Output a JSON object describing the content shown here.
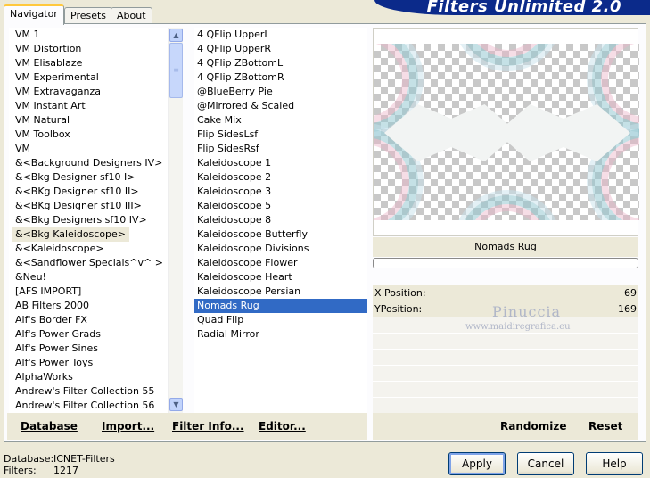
{
  "banner": {
    "title": "Filters Unlimited 2.0"
  },
  "tabs": [
    {
      "label": "Navigator",
      "active": true
    },
    {
      "label": "Presets",
      "active": false
    },
    {
      "label": "About",
      "active": false
    }
  ],
  "categories": [
    "VM 1",
    "VM Distortion",
    "VM Elisablaze",
    "VM Experimental",
    "VM Extravaganza",
    "VM Instant Art",
    "VM Natural",
    "VM Toolbox",
    "VM",
    "&<Background Designers IV>",
    "&<Bkg Designer sf10 I>",
    "&<BKg Designer sf10 II>",
    "&<BKg Designer sf10 III>",
    "&<Bkg Designers sf10 IV>",
    "&<Bkg Kaleidoscope>",
    "&<Kaleidoscope>",
    "&<Sandflower Specials^v^ >",
    "&Neu!",
    "[AFS IMPORT]",
    "AB Filters 2000",
    "Alf's Border FX",
    "Alf's Power Grads",
    "Alf's Power Sines",
    "Alf's Power Toys",
    "AlphaWorks",
    "Andrew's Filter Collection 55",
    "Andrew's Filter Collection 56"
  ],
  "selected_category": "&<Bkg Kaleidoscope>",
  "filters": [
    "4 QFlip UpperL",
    "4 QFlip UpperR",
    "4 QFlip ZBottomL",
    "4 QFlip ZBottomR",
    "@BlueBerry Pie",
    "@Mirrored & Scaled",
    "Cake Mix",
    "Flip SidesLsf",
    "Flip SidesRsf",
    "Kaleidoscope 1",
    "Kaleidoscope 2",
    "Kaleidoscope 3",
    "Kaleidoscope 5",
    "Kaleidoscope 8",
    "Kaleidoscope Butterfly",
    "Kaleidoscope Divisions",
    "Kaleidoscope Flower",
    "Kaleidoscope Heart",
    "Kaleidoscope Persian",
    "Nomads Rug",
    "Quad Flip",
    "Radial Mirror"
  ],
  "selected_filter": "Nomads Rug",
  "preview": {
    "filter_name": "Nomads Rug"
  },
  "params": [
    {
      "label": "X Position:",
      "value": "69"
    },
    {
      "label": "YPosition:",
      "value": "169"
    }
  ],
  "watermark": {
    "name": "Pinuccia",
    "url": "www.maidiregrafica.eu"
  },
  "toolbar": {
    "database": "Database",
    "import": "Import...",
    "filter_info": "Filter Info...",
    "editor": "Editor...",
    "randomize": "Randomize",
    "reset": "Reset"
  },
  "status": {
    "database_label": "Database:",
    "database_value": "ICNET-Filters",
    "filters_label": "Filters:",
    "filters_value": "1217"
  },
  "buttons": {
    "apply": "Apply",
    "cancel": "Cancel",
    "help": "Help"
  },
  "colors": {
    "selection": "#316ac5",
    "banner": "#0b2a8a",
    "face": "#ece9d8"
  }
}
